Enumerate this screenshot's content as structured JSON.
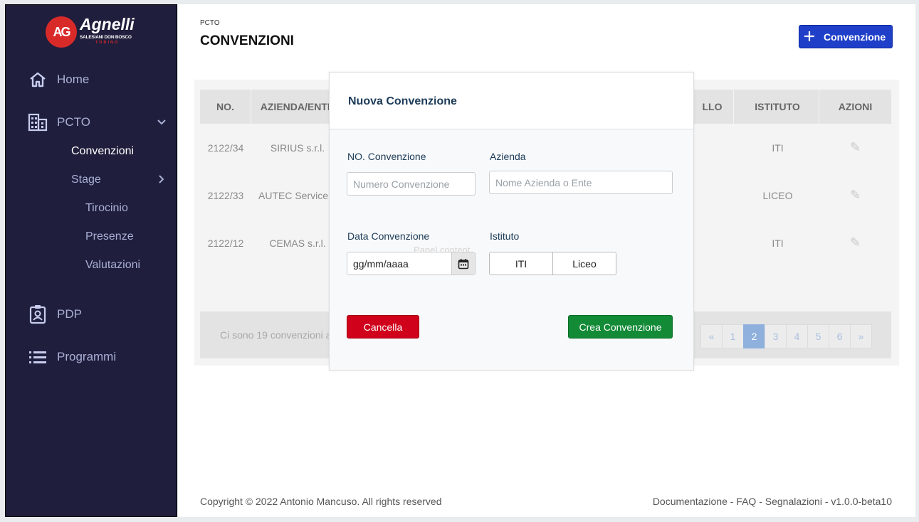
{
  "brand": {
    "logo_initials": "AG",
    "name": "Agnelli",
    "subtitle": "SALESIANI DON BOSCO",
    "city": "TORINO"
  },
  "sidebar": {
    "items": [
      {
        "label": "Home",
        "icon": "home-icon"
      },
      {
        "label": "PCTO",
        "icon": "building-icon",
        "chevron": "⌄"
      },
      {
        "label": "PDP",
        "icon": "id-badge-icon"
      },
      {
        "label": "Programmi",
        "icon": "list-icon"
      }
    ],
    "pcto_sub": [
      {
        "label": "Convenzioni"
      },
      {
        "label": "Stage",
        "chevron": "›"
      }
    ],
    "stage_sub": [
      {
        "label": "Tirocinio"
      },
      {
        "label": "Presenze"
      },
      {
        "label": "Valutazioni"
      }
    ]
  },
  "header": {
    "breadcrumb": "PCTO",
    "title": "CONVENZIONI",
    "add_button": "Convenzione"
  },
  "table": {
    "columns": [
      "NO.",
      "AZIENDA/ENTE",
      "LLO",
      "ISTITUTO",
      "AZIONI"
    ],
    "rows": [
      {
        "no": "2122/34",
        "azienda": "SIRIUS s.r.l.",
        "istituto": "ITI"
      },
      {
        "no": "2122/33",
        "azienda": "AUTEC Service",
        "istituto": "LICEO"
      },
      {
        "no": "2122/12",
        "azienda": "CEMAS s.r.l.",
        "istituto": "ITI"
      }
    ],
    "footer_text": "Ci sono 19 convenzioni a",
    "pagination": [
      "«",
      "1",
      "2",
      "3",
      "4",
      "5",
      "6",
      "»"
    ],
    "current_page": "2"
  },
  "modal": {
    "title": "Nuova Convenzione",
    "no_label": "NO. Convenzione",
    "no_placeholder": "Numero Convenzione",
    "azienda_label": "Azienda",
    "azienda_placeholder": "Nome Azienda o Ente",
    "data_label": "Data Convenzione",
    "data_value": "gg/mm/aaaa",
    "istituto_label": "Istituto",
    "istituto_options": [
      "ITI",
      "Liceo"
    ],
    "ghost_text": "Panel content",
    "cancel": "Cancella",
    "create": "Crea Convenzione"
  },
  "footer": {
    "copyright": "Copyright © 2022 Antonio Mancuso. All rights reserved",
    "links": "Documentazione - FAQ - Segnalazioni  - v1.0.0-beta10"
  }
}
